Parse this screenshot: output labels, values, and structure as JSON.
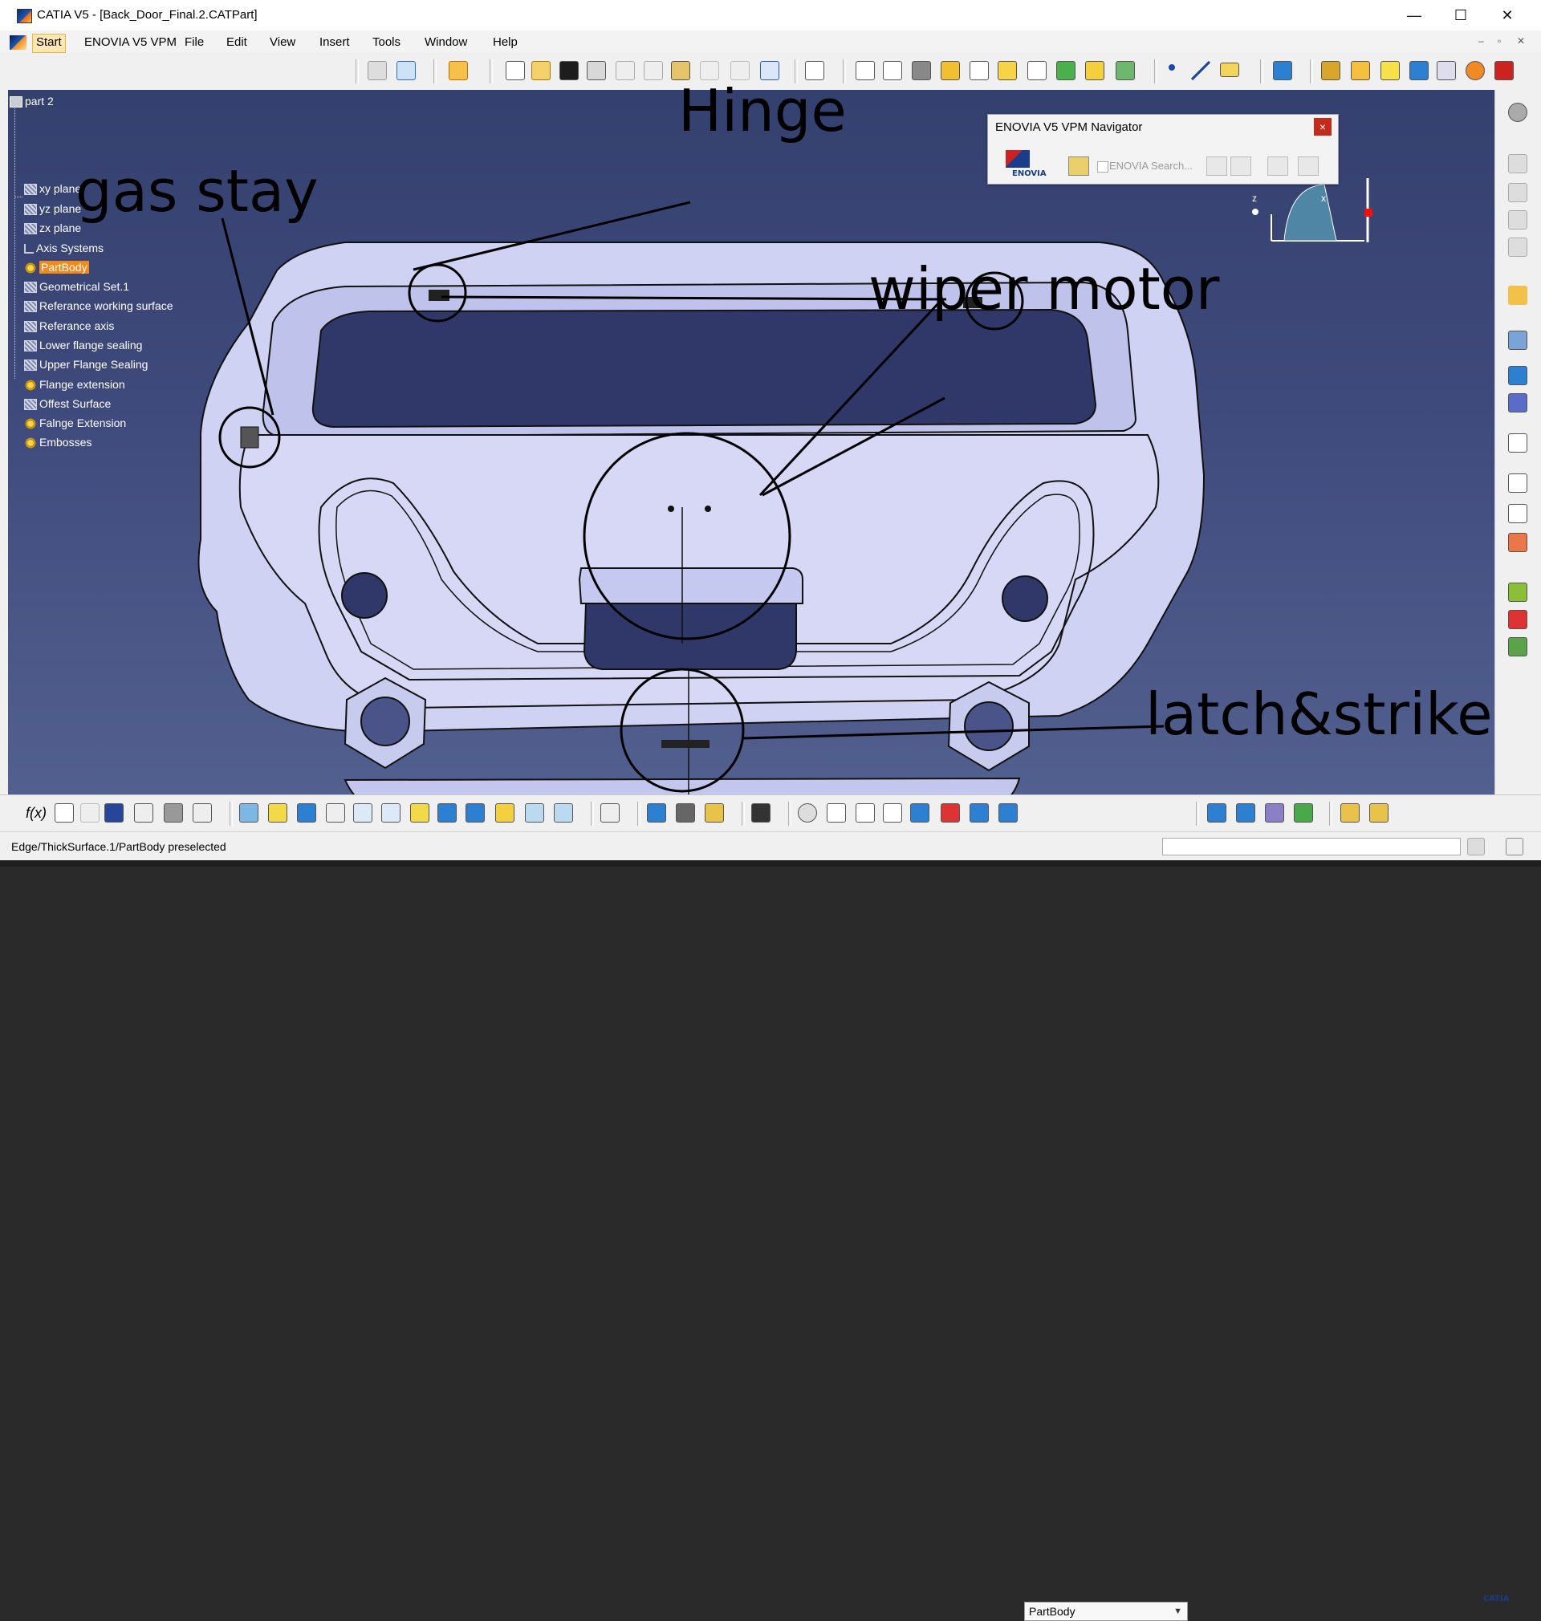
{
  "window": {
    "title": "CATIA V5 - [Back_Door_Final.2.CATPart]",
    "minimize": "—",
    "maximize": "☐",
    "close": "✕"
  },
  "menu": {
    "items": [
      "Start",
      "ENOVIA V5 VPM",
      "File",
      "Edit",
      "View",
      "Insert",
      "Tools",
      "Window",
      "Help"
    ],
    "doc_controls": [
      "–",
      "▫",
      "✕"
    ]
  },
  "tree": {
    "root": "part 2",
    "items": [
      {
        "label": "xy plane",
        "icon": "plane-icon"
      },
      {
        "label": "yz plane",
        "icon": "plane-icon"
      },
      {
        "label": "zx plane",
        "icon": "plane-icon"
      },
      {
        "label": "Axis Systems",
        "icon": "axis-icon"
      },
      {
        "label": "PartBody",
        "icon": "partbody-gear-icon",
        "highlight": true
      },
      {
        "label": "Geometrical Set.1",
        "icon": "geometrical-set-icon"
      },
      {
        "label": "Referance working surface",
        "icon": "geometrical-set-icon"
      },
      {
        "label": "Referance axis",
        "icon": "geometrical-set-icon"
      },
      {
        "label": "Lower flange sealing",
        "icon": "geometrical-set-icon"
      },
      {
        "label": "Upper Flange Sealing",
        "icon": "geometrical-set-icon"
      },
      {
        "label": "Flange extension",
        "icon": "surface-feature-icon"
      },
      {
        "label": "Offest Surface",
        "icon": "geometrical-set-icon"
      },
      {
        "label": "Falnge Extension",
        "icon": "surface-feature-icon"
      },
      {
        "label": "Embosses",
        "icon": "surface-feature-icon"
      }
    ]
  },
  "annotations": {
    "hinge": "Hinge",
    "gas_stay": "gas stay",
    "wiper_motor": "wiper motor",
    "latch_striker": "latch&striker"
  },
  "enovia_navigator": {
    "title": "ENOVIA V5 VPM Navigator",
    "close": "×",
    "logo_text": "ENOVIA",
    "search_label": "ENOVIA Search..."
  },
  "compass": {
    "z_label": "z",
    "x_label": "x"
  },
  "bottom_toolbar": {
    "formula_label": "f(x)",
    "body_combo_value": "PartBody",
    "catia_logo_text": "CATIA"
  },
  "status": {
    "message": "Edge/ThickSurface.1/PartBody preselected"
  },
  "colors": {
    "viewport_bg": "#3f4a7c",
    "part_surface": "#c9cdf0",
    "highlight": "#f28a1b",
    "close_red": "#c42b1c"
  }
}
